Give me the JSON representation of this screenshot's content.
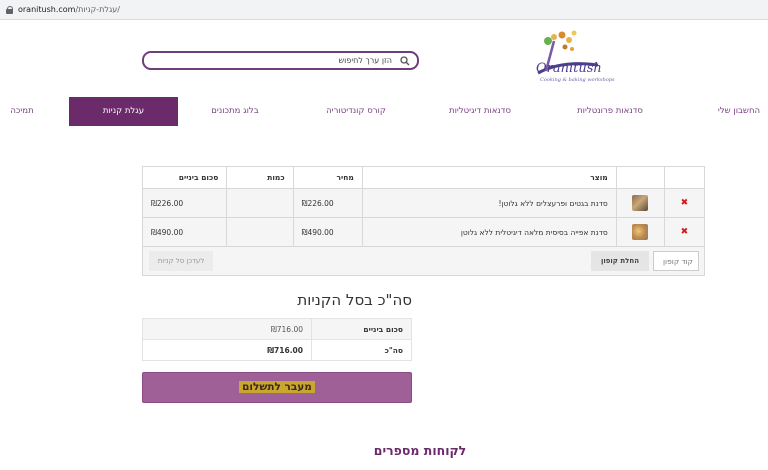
{
  "browser": {
    "host": "oranitush.com",
    "path": "/עגלת-קניות/"
  },
  "brand": {
    "name": "Oranitush",
    "tagline": "Cooking & baking workshops",
    "accent": "#6b2a69"
  },
  "search": {
    "placeholder": "הזן ערך לחיפוש"
  },
  "nav": {
    "items": [
      {
        "label": "החשבון שלי",
        "active": false
      },
      {
        "label": "סדנאות פרונטליות",
        "active": false
      },
      {
        "label": "סדנאות דיגיטליות",
        "active": false
      },
      {
        "label": "קורס קונדיטוריה",
        "active": false
      },
      {
        "label": "בלוג מתכונים",
        "active": false
      },
      {
        "label": "עגלת קניות",
        "active": true
      },
      {
        "label": "תמיכה",
        "active": false
      }
    ]
  },
  "cart": {
    "headers": {
      "product": "מוצר",
      "price": "מחיר",
      "quantity": "כמות",
      "subtotal": "סכום ביניים"
    },
    "rows": [
      {
        "name": "סדנת בגטים ופרעצלים ללא גלוטן!",
        "price": "₪226.00",
        "quantity": "",
        "subtotal": "₪226.00"
      },
      {
        "name": "סדנת אפייה בסיסית מלאה דיגיטלית ללא גלוטן",
        "price": "₪490.00",
        "quantity": "",
        "subtotal": "₪490.00"
      }
    ],
    "coupon_placeholder": "קוד קופון",
    "apply_coupon_label": "החלת קופון",
    "update_cart_label": "לעדכן סל קניות"
  },
  "totals": {
    "title": "סה\"כ בסל הקניות",
    "subtotal_label": "סכום ביניים",
    "subtotal_value": "₪716.00",
    "total_label": "סה\"כ",
    "total_value": "₪716.00"
  },
  "checkout_label": "מעבר לתשלום",
  "customers_heading": "לקוחות מספרים"
}
